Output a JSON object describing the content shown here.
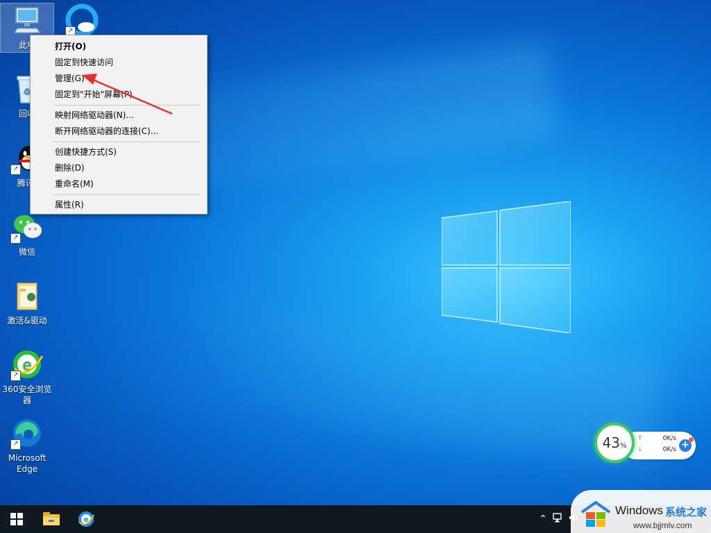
{
  "desktop": {
    "icons": [
      {
        "label": "此电",
        "icon": "this-pc-icon"
      },
      {
        "label": "",
        "icon": "360-browser-icon"
      },
      {
        "label": "回收",
        "icon": "recycle-bin-icon"
      },
      {
        "label": "腾讯(",
        "icon": "qq-icon"
      },
      {
        "label": "微信",
        "icon": "wechat-icon"
      },
      {
        "label": "激活&驱动",
        "icon": "folder-icon"
      },
      {
        "label": "360安全浏览器",
        "icon": "360-browser-icon"
      },
      {
        "label": "Microsoft Edge",
        "icon": "edge-icon"
      }
    ]
  },
  "context_menu": {
    "items": [
      {
        "label": "打开(O)",
        "bold": true
      },
      {
        "label": "固定到快速访问"
      },
      {
        "label": "管理(G)"
      },
      {
        "label": "固定到\"开始\"屏幕(P)"
      },
      {
        "label": "映射网络驱动器(N)..."
      },
      {
        "label": "断开网络驱动器的连接(C)..."
      },
      {
        "label": "创建快捷方式(S)"
      },
      {
        "label": "删除(D)"
      },
      {
        "label": "重命名(M)"
      },
      {
        "label": "属性(R)"
      }
    ],
    "annotation_color": "#e8302c"
  },
  "speed_widget": {
    "percent": "43",
    "percent_unit": "%",
    "upload": "0K/s",
    "download": "0K/s",
    "ring_color": "#42c76a"
  },
  "taskbar": {
    "start_icon": "windows-start-icon",
    "pinned": [
      "file-explorer-icon",
      "ie-browser-icon"
    ],
    "tray": [
      "chevron-up-icon",
      "network-icon",
      "volume-icon"
    ]
  },
  "watermark": {
    "brand": "Windows",
    "brand_cn": "系统之家",
    "url": "www.bjjmlv.com"
  }
}
